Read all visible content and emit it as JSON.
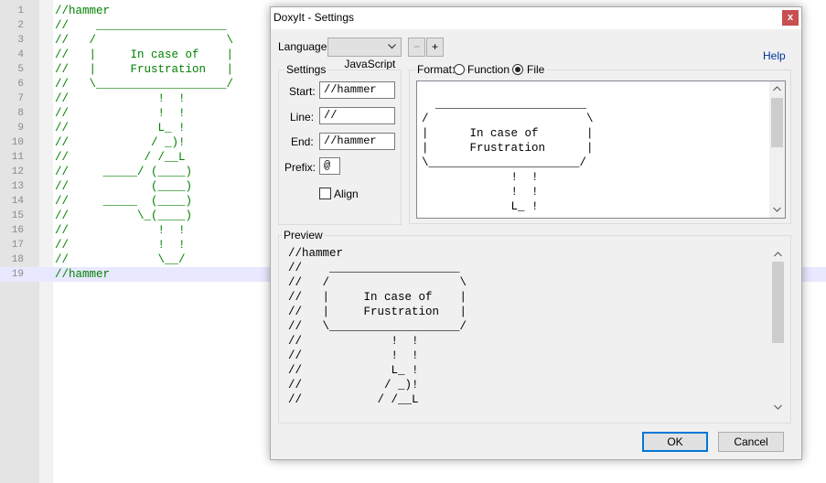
{
  "editor": {
    "active_line": 19,
    "lines": [
      {
        "num": "1",
        "text": "//hammer"
      },
      {
        "num": "2",
        "text": "//    ___________________"
      },
      {
        "num": "3",
        "text": "//   /                   \\"
      },
      {
        "num": "4",
        "text": "//   |     In case of    |"
      },
      {
        "num": "5",
        "text": "//   |     Frustration   |"
      },
      {
        "num": "6",
        "text": "//   \\___________________/"
      },
      {
        "num": "7",
        "text": "//             !  !"
      },
      {
        "num": "8",
        "text": "//             !  !"
      },
      {
        "num": "9",
        "text": "//             L_ !"
      },
      {
        "num": "10",
        "text": "//            / _)!"
      },
      {
        "num": "11",
        "text": "//           / /__L"
      },
      {
        "num": "12",
        "text": "//     _____/ (____)"
      },
      {
        "num": "13",
        "text": "//            (____)"
      },
      {
        "num": "14",
        "text": "//     _____  (____)"
      },
      {
        "num": "15",
        "text": "//          \\_(____)"
      },
      {
        "num": "16",
        "text": "//             !  !"
      },
      {
        "num": "17",
        "text": "//             !  !"
      },
      {
        "num": "18",
        "text": "//             \\__/"
      },
      {
        "num": "19",
        "text": "//hammer"
      }
    ]
  },
  "dialog": {
    "title": "DoxyIt - Settings",
    "close_glyph": "x",
    "language_label": "Language:",
    "language_value": "JavaScript",
    "remove_btn": "−",
    "add_btn": "+",
    "help_link": "Help",
    "settings_group": "Settings",
    "start_label": "Start:",
    "start_value": "//hammer",
    "line_label": "Line:",
    "line_value": "//",
    "end_label": "End:",
    "end_value": "//hammer",
    "prefix_label": "Prefix:",
    "prefix_value": "@",
    "align_label": "Align",
    "format_label": "Format:",
    "format_function": "Function",
    "format_file": "File",
    "format_selected": "File",
    "format_lines": [
      "",
      "  ______________________",
      "/                       \\",
      "|      In case of       |",
      "|      Frustration      |",
      "\\______________________/",
      "             !  !",
      "             !  !",
      "             L_ !"
    ],
    "preview_group": "Preview",
    "preview_lines": [
      "//hammer",
      "//    ___________________",
      "//   /                   \\",
      "//   |     In case of    |",
      "//   |     Frustration   |",
      "//   \\___________________/",
      "//             !  !",
      "//             !  !",
      "//             L_ !",
      "//            / _)!",
      "//           / /__L"
    ],
    "ok_label": "OK",
    "cancel_label": "Cancel"
  },
  "colors": {
    "comment_green": "#008000",
    "active_line_bg": "#e8e8ff",
    "close_red": "#c75050",
    "help_blue": "#003399",
    "ok_border": "#0078d7"
  },
  "icons": {
    "close": "x",
    "dropdown": "chevron-down-icon",
    "scroll_up": "chevron-up-icon",
    "scroll_down": "chevron-down-icon"
  }
}
